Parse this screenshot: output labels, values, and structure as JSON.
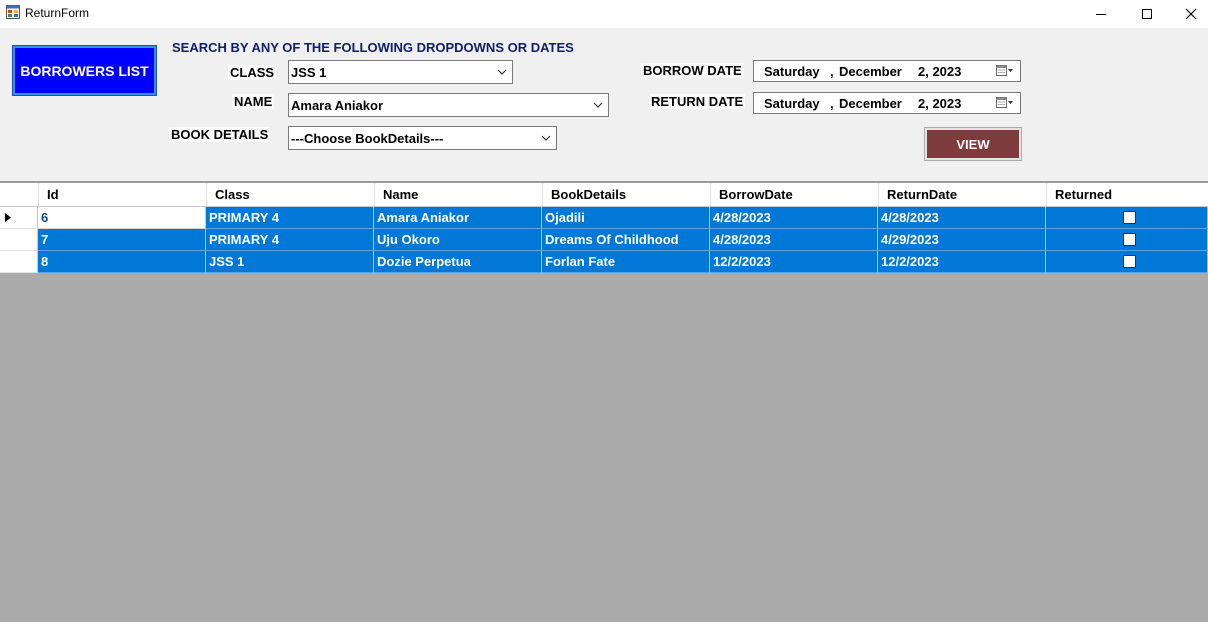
{
  "window": {
    "title": "ReturnForm"
  },
  "buttons": {
    "borrowers_list": "BORROWERS LIST",
    "view": "VIEW"
  },
  "search": {
    "heading": "SEARCH BY ANY OF THE FOLLOWING DROPDOWNS OR DATES",
    "class_label": "CLASS",
    "class_value": "JSS 1",
    "name_label": "NAME",
    "name_value": "Amara Aniakor",
    "book_label": "BOOK DETAILS",
    "book_value": "---Choose BookDetails---",
    "borrow_label": "BORROW DATE",
    "return_label": "RETURN DATE",
    "borrow_date": {
      "weekday": "Saturday",
      "month": "December",
      "day": "2, 2023"
    },
    "return_date": {
      "weekday": "Saturday",
      "month": "December",
      "day": "2, 2023"
    }
  },
  "grid": {
    "columns": [
      "Id",
      "Class",
      "Name",
      "BookDetails",
      "BorrowDate",
      "ReturnDate",
      "Returned"
    ],
    "rows": [
      {
        "id": "6",
        "class": "PRIMARY 4",
        "name": "Amara Aniakor",
        "book": "Ojadili",
        "borrow": "4/28/2023",
        "ret": "4/28/2023",
        "returned": false
      },
      {
        "id": "7",
        "class": "PRIMARY 4",
        "name": "Uju Okoro",
        "book": "Dreams Of Childhood",
        "borrow": "4/28/2023",
        "ret": "4/29/2023",
        "returned": false
      },
      {
        "id": "8",
        "class": "JSS 1",
        "name": "Dozie Perpetua",
        "book": "Forlan Fate",
        "borrow": "12/2/2023",
        "ret": "12/2/2023",
        "returned": false
      }
    ]
  },
  "colors": {
    "selection": "#0078d7",
    "borrowers_button": "#0000ff",
    "view_button": "#7e3b3c"
  },
  "icons": [
    "app-icon",
    "minimize-icon",
    "maximize-icon",
    "close-icon",
    "chevron-down-icon",
    "calendar-icon",
    "row-pointer-icon"
  ]
}
